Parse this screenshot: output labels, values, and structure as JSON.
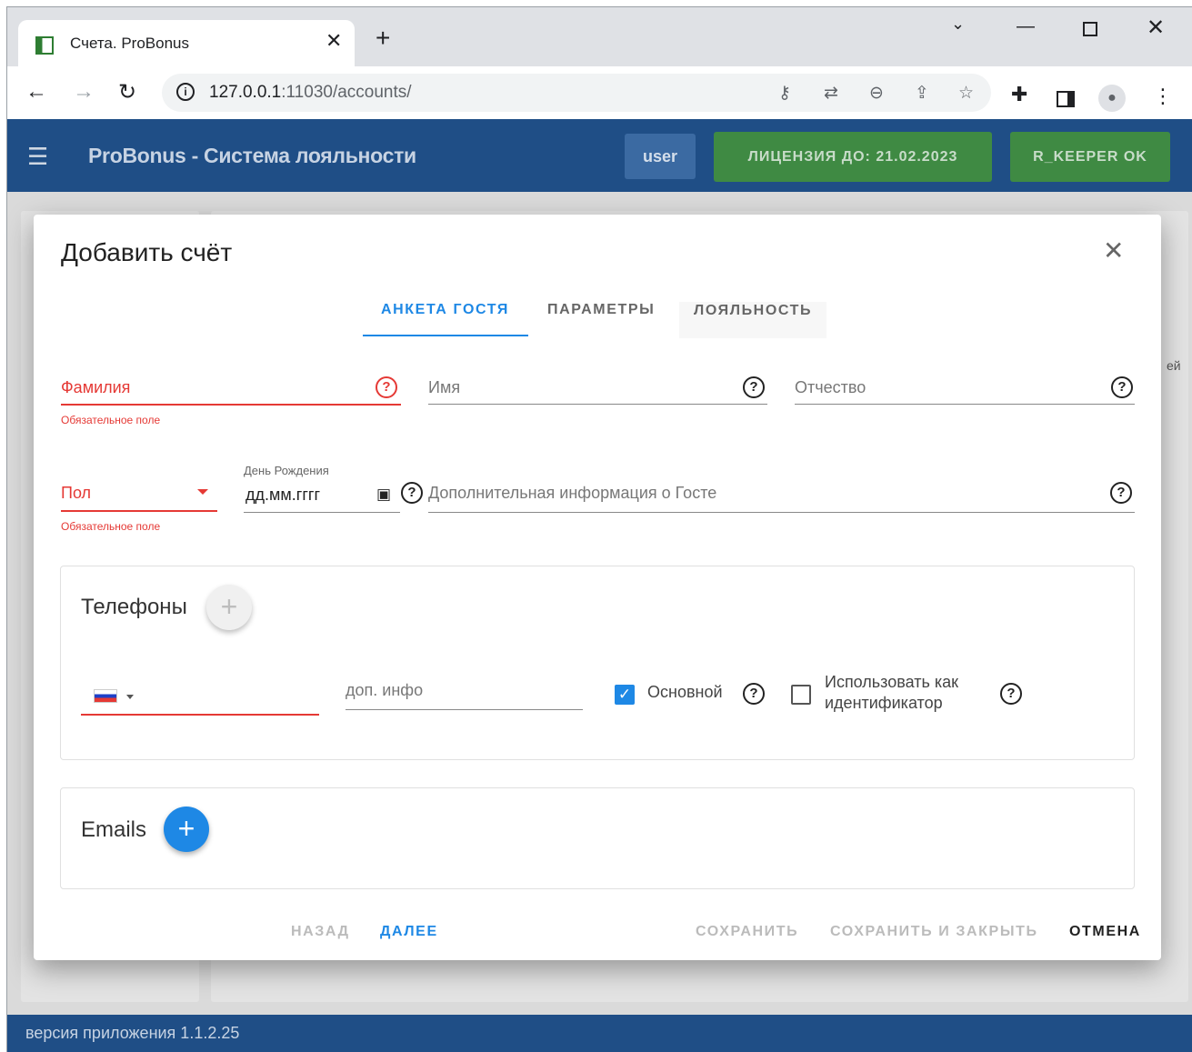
{
  "browser": {
    "tab_title": "Счета. ProBonus",
    "url_host": "127.0.0.1",
    "url_rest": ":11030/accounts/"
  },
  "app": {
    "title": "ProBonus - Система лояльности",
    "user_label": "user",
    "license_label": "ЛИЦЕНЗИЯ ДО: 21.02.2023",
    "rkeeper_label": "R_KEEPER OK",
    "background_fragment": "ей",
    "version": "версия приложения 1.1.2.25",
    "colors": {
      "appbar": "#1f4e86",
      "status_ok": "#3f8a43",
      "accent": "#1e88e5",
      "error": "#e53935"
    }
  },
  "dialog": {
    "title": "Добавить счёт",
    "tabs": [
      {
        "label": "АНКЕТА ГОСТЯ",
        "active": true
      },
      {
        "label": "ПАРАМЕТРЫ",
        "active": false
      },
      {
        "label": "ЛОЯЛЬНОСТЬ",
        "active": false
      }
    ],
    "fields": {
      "last_name": {
        "label": "Фамилия",
        "error": "Обязательное поле"
      },
      "first_name": {
        "label": "Имя"
      },
      "middle_name": {
        "label": "Отчество"
      },
      "gender": {
        "label": "Пол",
        "error": "Обязательное поле"
      },
      "birthday": {
        "caption": "День Рождения",
        "placeholder": "дд.мм.гггг"
      },
      "extra_info": {
        "label": "Дополнительная информация о Госте"
      }
    },
    "phones": {
      "title": "Телефоны",
      "extra_placeholder": "доп. инфо",
      "main_label": "Основной",
      "main_checked": true,
      "identifier_label": "Использовать как идентификатор",
      "identifier_checked": false
    },
    "emails": {
      "title": "Emails"
    },
    "actions": {
      "back": "НАЗАД",
      "next": "ДАЛЕЕ",
      "save": "СОХРАНИТЬ",
      "save_close": "СОХРАНИТЬ И ЗАКРЫТЬ",
      "cancel": "ОТМЕНА"
    }
  }
}
